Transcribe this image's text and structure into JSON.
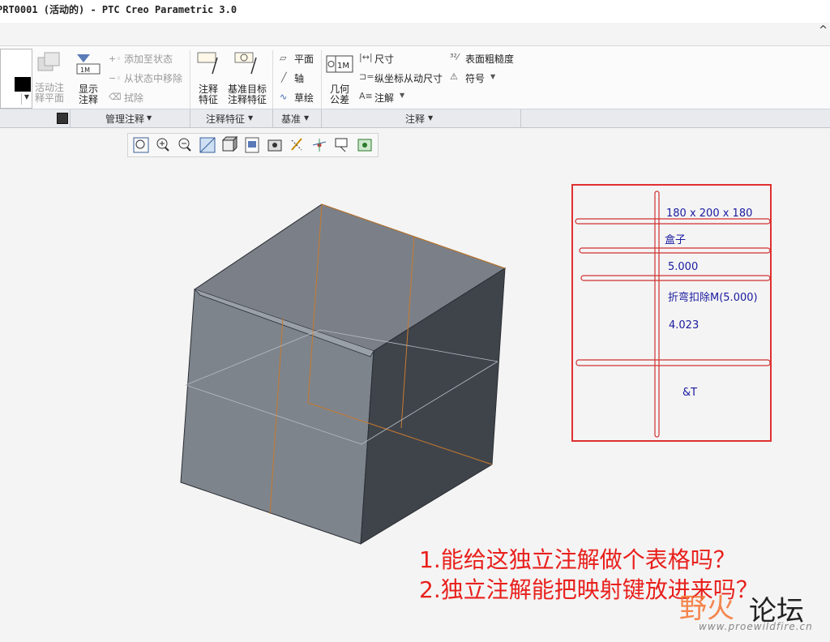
{
  "window": {
    "title": "PRT0001 (活动的) - PTC Creo Parametric 3.0",
    "caret": "^"
  },
  "ribbon": {
    "activate_label": "活动注\n释平面",
    "show_label": "显示\n注释",
    "add_state": "添加至状态",
    "remove_state": "从状态中移除",
    "erase": "拭除",
    "annot_feature_label": "注释\n特征",
    "datum_target_label": "基准目标\n注释特征",
    "plane": "平面",
    "axis": "轴",
    "sketch": "草绘",
    "gtol_label": "几何\n公差",
    "dimension": "尺寸",
    "ordinate": "纵坐标从动尺寸",
    "note": "注解",
    "roughness": "表面粗糙度",
    "symbol": "符号"
  },
  "groups": {
    "manage": "管理注释",
    "annot_features": "注释特征",
    "datum": "基准",
    "annotations": "注释"
  },
  "view_toolbar": {
    "icons": [
      "refit-icon",
      "zoom-in-icon",
      "zoom-out-icon",
      "repaint-icon",
      "display-style-icon",
      "saved-views-icon",
      "view-manager-icon",
      "datum-display-icon",
      "spin-center-icon",
      "annotation-display-icon",
      "appearance-icon"
    ]
  },
  "note_table": {
    "lines": [
      "180 x 200 x 180",
      "盒子",
      "5.000",
      "折弯扣除M(5.000)",
      "4.023",
      "&T"
    ]
  },
  "questions": [
    "1.能给这独立注解做个表格吗？",
    "2.独立注解能把映射键放进来吗？"
  ],
  "watermark": {
    "brand_a": "野火",
    "brand_b": "论坛",
    "url": "www.proewildfire.cn"
  },
  "colors": {
    "accent_red": "#e03030",
    "note_blue": "#1a1aa0",
    "cube_face": "#7d848c"
  }
}
